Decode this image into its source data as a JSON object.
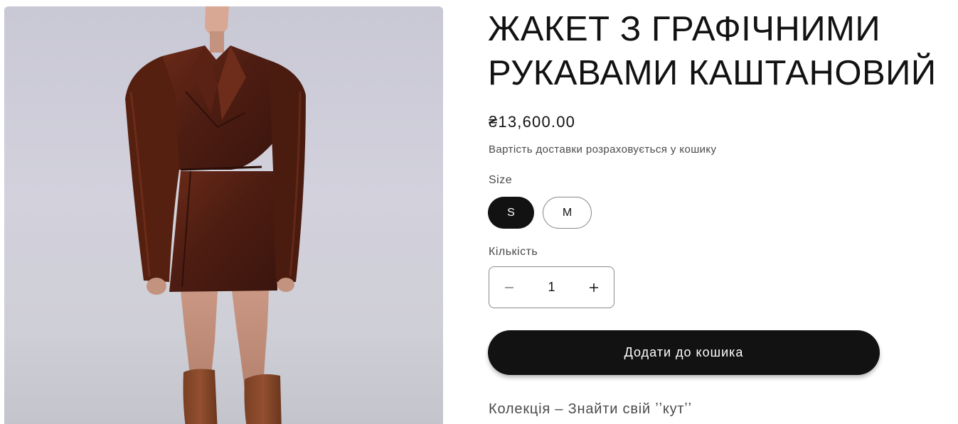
{
  "product": {
    "title": "ЖАКЕТ З ГРАФІЧНИМИ РУКАВАМИ КАШТАНОВИЙ",
    "price": "₴13,600.00",
    "shipping_note": "Вартість доставки розраховується у кошику",
    "image_subject": "model wearing brown cropped leather jacket with sculpted shoulders, mini skirt and brown knee boots"
  },
  "size": {
    "label": "Size",
    "options": [
      {
        "label": "S",
        "selected": true
      },
      {
        "label": "M",
        "selected": false
      }
    ]
  },
  "quantity": {
    "label": "Кількість",
    "value": "1",
    "decrease_icon": "minus-icon",
    "increase_icon": "plus-icon"
  },
  "actions": {
    "add_to_cart": "Додати до кошика"
  },
  "collection": {
    "text": "Колекція – Знайти свій ʼʼкутʼʼ"
  },
  "colors": {
    "text_primary": "#121212",
    "text_secondary": "#4a4a4a",
    "button_bg": "#121212",
    "button_text": "#ffffff",
    "border": "#8a8a8a"
  }
}
